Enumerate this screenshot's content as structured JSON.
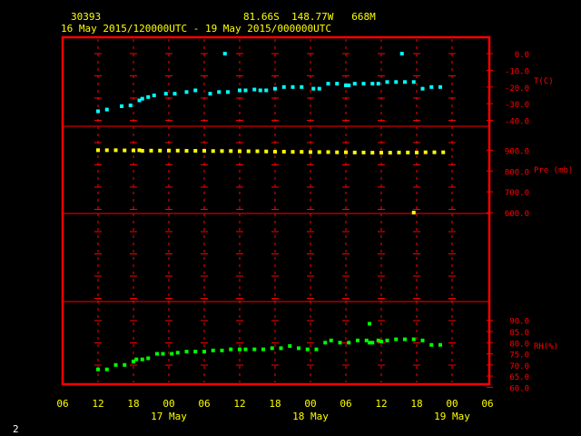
{
  "header": {
    "station_id": "30393",
    "location": "81.66S  148.77W   668M",
    "period": "16 May 2015/120000UTC - 19 May 2015/000000UTC"
  },
  "footer": {
    "page_number": "2"
  },
  "colors": {
    "background": "#000000",
    "frame": "#ff0000",
    "axis_text": "#ffff00",
    "right_labels": "#ff0000",
    "header_text": "#ffff00",
    "temperature": "#00ffff",
    "pressure": "#ffff00",
    "humidity": "#00ff00"
  },
  "chart_data": {
    "type": "scatter",
    "x_ticks": [
      "06",
      "12",
      "18",
      "00",
      "06",
      "12",
      "18",
      "00",
      "06",
      "12",
      "18",
      "00",
      "06"
    ],
    "x_tick_hours": [
      -6,
      0,
      6,
      12,
      18,
      24,
      30,
      36,
      42,
      48,
      54,
      60,
      66
    ],
    "xlim_hours_from_start": [
      -6,
      66
    ],
    "date_labels": [
      {
        "label": "17 May",
        "hour": 12
      },
      {
        "label": "18 May",
        "hour": 36
      },
      {
        "label": "19 May",
        "hour": 60
      }
    ],
    "grid": true,
    "panels": [
      {
        "name": "temperature",
        "label": "T(C)",
        "ticks": [
          {
            "v": 0,
            "label": "0.0"
          },
          {
            "v": -10,
            "label": "-10.0"
          },
          {
            "v": -20,
            "label": "-20.0"
          },
          {
            "v": -30,
            "label": "-30.0"
          },
          {
            "v": -40,
            "label": "-40.0"
          }
        ],
        "ylim": [
          -43.5,
          6
        ],
        "points": [
          [
            0,
            -34.5
          ],
          [
            1.5,
            -33.5
          ],
          [
            4,
            -31.5
          ],
          [
            5.5,
            -31
          ],
          [
            7,
            -28
          ],
          [
            7.5,
            -27
          ],
          [
            8.5,
            -26
          ],
          [
            9.5,
            -25
          ],
          [
            11.5,
            -24
          ],
          [
            13,
            -24
          ],
          [
            15,
            -23
          ],
          [
            16.5,
            -22
          ],
          [
            19,
            -24
          ],
          [
            20.5,
            -23
          ],
          [
            22,
            -23
          ],
          [
            24,
            -22
          ],
          [
            25,
            -22
          ],
          [
            26.5,
            -21.5
          ],
          [
            27.5,
            -22
          ],
          [
            28.5,
            -22
          ],
          [
            30,
            -21
          ],
          [
            31.5,
            -20
          ],
          [
            33,
            -20
          ],
          [
            34.5,
            -20
          ],
          [
            36.5,
            -21
          ],
          [
            37.5,
            -21
          ],
          [
            21.5,
            0
          ],
          [
            39,
            -18
          ],
          [
            40.5,
            -18
          ],
          [
            42,
            -19
          ],
          [
            42.5,
            -19
          ],
          [
            43.5,
            -18
          ],
          [
            45,
            -18
          ],
          [
            46.5,
            -18
          ],
          [
            47.5,
            -18
          ],
          [
            49,
            -17
          ],
          [
            50.5,
            -17
          ],
          [
            52,
            -17
          ],
          [
            53.5,
            -17
          ],
          [
            51.5,
            0
          ],
          [
            55,
            -21
          ],
          [
            56.5,
            -20
          ],
          [
            58,
            -20
          ]
        ]
      },
      {
        "name": "pressure",
        "label": "Pre (mb)",
        "ticks": [
          {
            "v": 900,
            "label": "900.0"
          },
          {
            "v": 800,
            "label": "800.0"
          },
          {
            "v": 700,
            "label": "700.0"
          },
          {
            "v": 600,
            "label": "600.0"
          }
        ],
        "ylim": [
          596,
          1002
        ],
        "points": [
          [
            0,
            900
          ],
          [
            1.5,
            900
          ],
          [
            3,
            900
          ],
          [
            4.5,
            899
          ],
          [
            6,
            899
          ],
          [
            7,
            900
          ],
          [
            7.5,
            897
          ],
          [
            9,
            898
          ],
          [
            10.5,
            898
          ],
          [
            12,
            898
          ],
          [
            13.5,
            898
          ],
          [
            15,
            897
          ],
          [
            16.5,
            897
          ],
          [
            18,
            897
          ],
          [
            19.5,
            896
          ],
          [
            21,
            896
          ],
          [
            22.5,
            896
          ],
          [
            24,
            895
          ],
          [
            25.5,
            895
          ],
          [
            27,
            895
          ],
          [
            28.5,
            894
          ],
          [
            30,
            893
          ],
          [
            31.5,
            893
          ],
          [
            33,
            892
          ],
          [
            34.5,
            892
          ],
          [
            36,
            891
          ],
          [
            37.5,
            891
          ],
          [
            39,
            891
          ],
          [
            40.5,
            890
          ],
          [
            42,
            890
          ],
          [
            43.5,
            889
          ],
          [
            45,
            889
          ],
          [
            46.5,
            888
          ],
          [
            48,
            888
          ],
          [
            49.5,
            888
          ],
          [
            51,
            889
          ],
          [
            52.5,
            889
          ],
          [
            54,
            889
          ],
          [
            55.5,
            890
          ],
          [
            57,
            890
          ],
          [
            58.5,
            890
          ],
          [
            53.5,
            600
          ]
        ]
      },
      {
        "name": "humidity",
        "label": "RH(%)",
        "ticks": [
          {
            "v": 90,
            "label": "90.0"
          },
          {
            "v": 85,
            "label": "85.0"
          },
          {
            "v": 80,
            "label": "80.0"
          },
          {
            "v": 75,
            "label": "75.0"
          },
          {
            "v": 70,
            "label": "70.0"
          },
          {
            "v": 65,
            "label": "65.0"
          },
          {
            "v": 60,
            "label": "60.0"
          }
        ],
        "ylim": [
          58.5,
          96
        ],
        "points": [
          [
            0,
            68
          ],
          [
            1.5,
            68
          ],
          [
            3,
            70
          ],
          [
            4.5,
            70
          ],
          [
            6,
            71.5
          ],
          [
            6.5,
            72.5
          ],
          [
            7.5,
            72.5
          ],
          [
            8.5,
            73
          ],
          [
            10,
            75
          ],
          [
            11,
            75
          ],
          [
            12.5,
            75
          ],
          [
            13.5,
            75.5
          ],
          [
            15,
            76
          ],
          [
            16.5,
            76
          ],
          [
            18,
            76
          ],
          [
            19.5,
            76.5
          ],
          [
            21,
            76.5
          ],
          [
            22.5,
            77
          ],
          [
            24,
            77
          ],
          [
            25,
            77
          ],
          [
            26.5,
            77
          ],
          [
            28,
            77
          ],
          [
            29.5,
            77.5
          ],
          [
            31,
            77.5
          ],
          [
            32.5,
            78.5
          ],
          [
            34,
            77.5
          ],
          [
            35.5,
            77
          ],
          [
            37,
            77
          ],
          [
            38.5,
            80
          ],
          [
            39.5,
            81
          ],
          [
            41,
            80
          ],
          [
            42.5,
            80
          ],
          [
            44,
            81
          ],
          [
            45.5,
            81
          ],
          [
            46,
            80
          ],
          [
            46.5,
            80
          ],
          [
            47.5,
            81
          ],
          [
            48,
            80.5
          ],
          [
            49,
            81
          ],
          [
            50.5,
            81.5
          ],
          [
            52,
            81.5
          ],
          [
            53.5,
            81.5
          ],
          [
            55,
            81
          ],
          [
            56.5,
            79
          ],
          [
            58,
            79
          ],
          [
            46,
            88.5
          ]
        ]
      }
    ]
  }
}
